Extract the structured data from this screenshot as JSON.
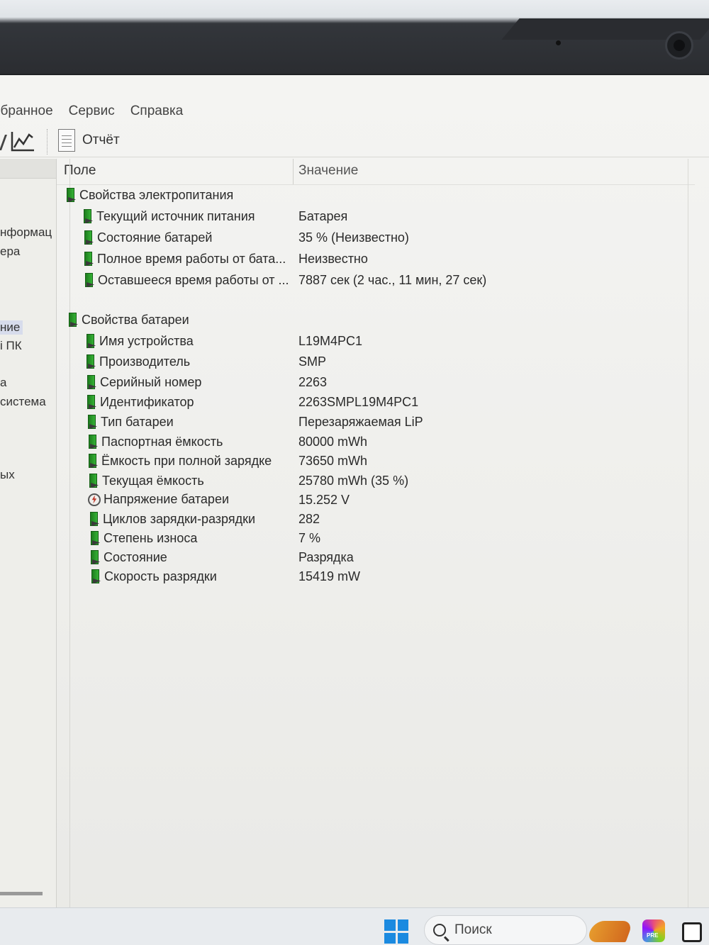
{
  "menu": [
    "збранное",
    "Сервис",
    "Справка"
  ],
  "toolbar": {
    "report_label": "Отчёт"
  },
  "left_tree": [
    "нформац",
    "ера",
    "ние",
    "і ПК",
    "а",
    "система",
    "ых"
  ],
  "columns": {
    "field": "Поле",
    "value": "Значение"
  },
  "groups": [
    {
      "label": "Свойства электропитания",
      "rows": [
        {
          "field": "Текущий источник питания",
          "value": "Батарея"
        },
        {
          "field": "Состояние батарей",
          "value": "35 % (Неизвестно)"
        },
        {
          "field": "Полное время работы от бата...",
          "value": "Неизвестно"
        },
        {
          "field": "Оставшееся время работы от ...",
          "value": "7887 сек (2 час., 11 мин, 27 сек)"
        }
      ]
    },
    {
      "label": "Свойства батареи",
      "rows": [
        {
          "field": "Имя устройства",
          "value": "L19M4PC1"
        },
        {
          "field": "Производитель",
          "value": "SMP"
        },
        {
          "field": "Серийный номер",
          "value": "2263"
        },
        {
          "field": "Идентификатор",
          "value": "2263SMPL19M4PC1"
        },
        {
          "field": "Тип батареи",
          "value": "Перезаряжаемая LiP"
        },
        {
          "field": "Паспортная ёмкость",
          "value": "80000 mWh"
        },
        {
          "field": "Ёмкость при полной зарядке",
          "value": "73650 mWh"
        },
        {
          "field": "Текущая ёмкость",
          "value": "25780 mWh  (35 %)"
        },
        {
          "field": "Напряжение батареи",
          "value": "15.252 V"
        },
        {
          "field": "Циклов зарядки-разрядки",
          "value": "282"
        },
        {
          "field": "Степень износа",
          "value": "7 %"
        },
        {
          "field": "Состояние",
          "value": "Разрядка"
        },
        {
          "field": "Скорость разрядки",
          "value": "15419 mW"
        }
      ]
    }
  ],
  "taskbar": {
    "search_placeholder": "Поиск",
    "app_badge": "PRE"
  },
  "icons": {
    "battery": "battery-icon",
    "voltage": "voltage-icon",
    "report": "document-icon",
    "chart": "line-chart-icon",
    "windows": "windows-start-icon",
    "search": "search-icon"
  },
  "colors": {
    "battery_green": "#2a9d2a",
    "windows_blue": "#1b8ae0"
  }
}
